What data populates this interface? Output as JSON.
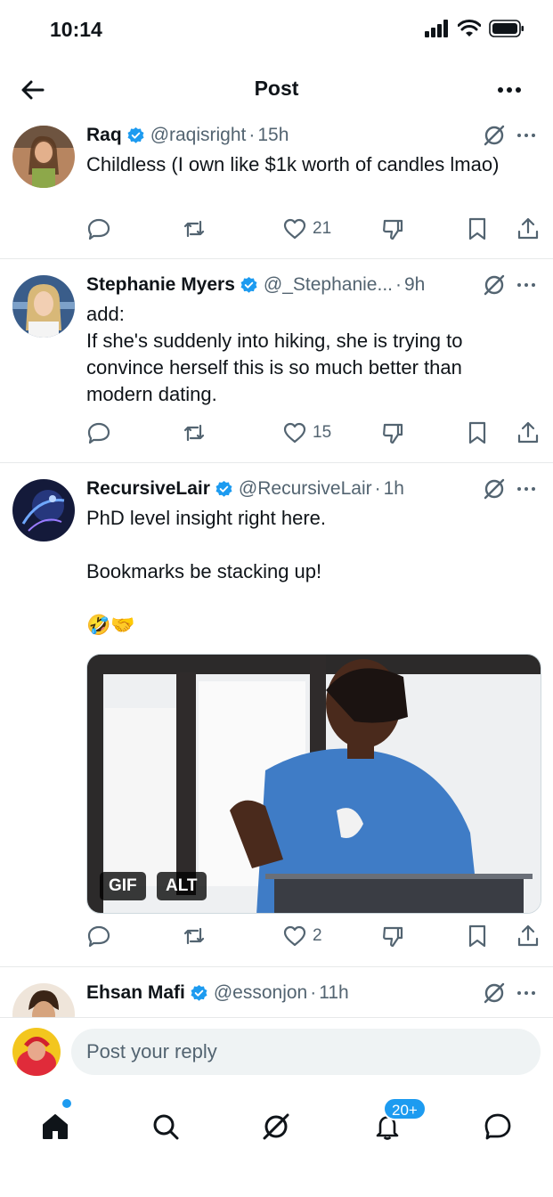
{
  "status_bar": {
    "time": "10:14"
  },
  "header": {
    "title": "Post"
  },
  "tweets": [
    {
      "name": "Raq",
      "handle": "@raqisright",
      "time": "15h",
      "text": "Childless (I own like $1k worth of candles lmao)",
      "likes": "21"
    },
    {
      "name": "Stephanie Myers",
      "handle": "@_Stephanie...",
      "time": "9h",
      "text_lines": [
        "add:",
        "If she's suddenly into hiking, she is trying to convince herself this is so much better than modern dating."
      ],
      "likes": "15"
    },
    {
      "name": "RecursiveLair",
      "handle": "@RecursiveLair",
      "time": "1h",
      "text_lines": [
        "PhD level insight right here.",
        "Bookmarks be stacking up!",
        "🤣🤝"
      ],
      "media_badges": [
        "GIF",
        "ALT"
      ],
      "likes": "2"
    },
    {
      "name": "Ehsan Mafi",
      "handle": "@essonjon",
      "time": "11h"
    }
  ],
  "reply": {
    "placeholder": "Post your reply"
  },
  "tabbar": {
    "notifications_badge": "20+"
  },
  "colors": {
    "accent": "#1d9bf0",
    "text": "#0f1419",
    "secondary": "#536471"
  },
  "icons": [
    "back-arrow-icon",
    "more-icon",
    "verified-icon",
    "grok-icon",
    "reply-icon",
    "retweet-icon",
    "heart-icon",
    "dislike-icon",
    "bookmark-icon",
    "share-icon",
    "home-icon",
    "search-icon",
    "grok-icon",
    "bell-icon",
    "chat-icon"
  ]
}
